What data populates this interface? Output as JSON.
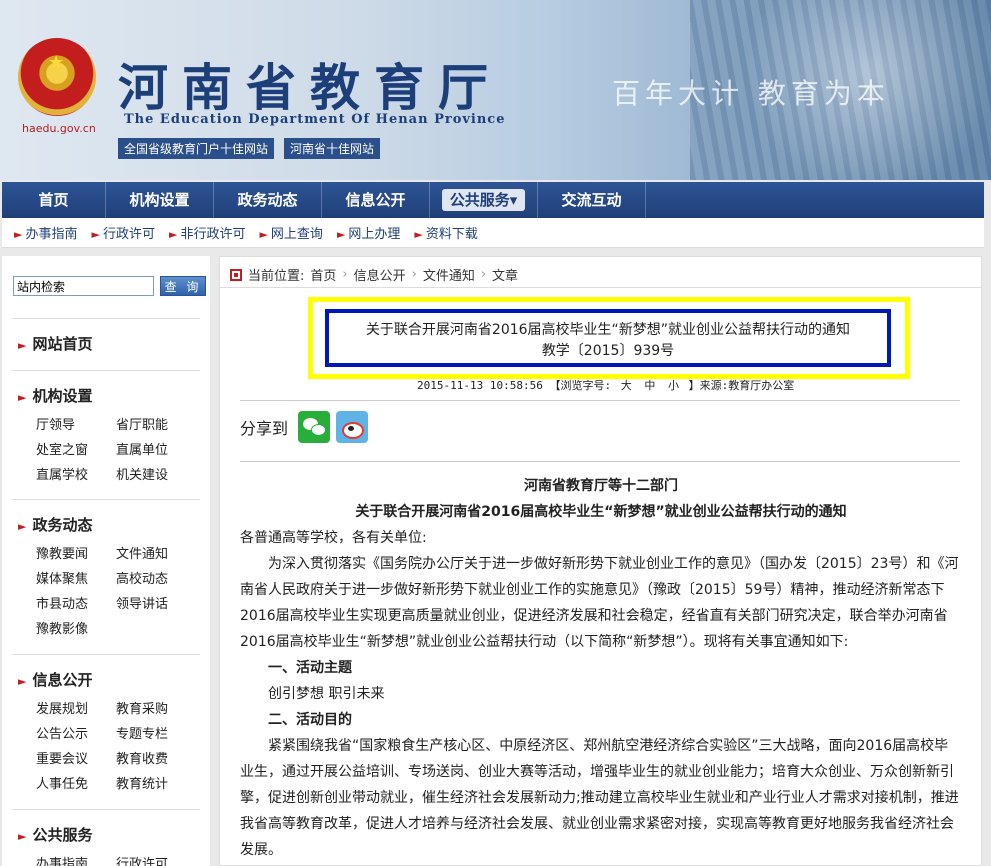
{
  "header": {
    "domain": "haedu.gov.cn",
    "title_cn": "河南省教育厅",
    "title_en": "The Education Department Of Henan Province",
    "badges": [
      "全国省级教育门户十佳网站",
      "河南省十佳网站"
    ],
    "slogan": "百年大计 教育为本"
  },
  "nav": {
    "items": [
      "首页",
      "机构设置",
      "政务动态",
      "信息公开",
      "公共服务",
      "交流互动"
    ],
    "active_dropdown_mark": "▾"
  },
  "subnav": {
    "items": [
      "办事指南",
      "行政许可",
      "非行政许可",
      "网上查询",
      "网上办理",
      "资料下载"
    ]
  },
  "sidebar": {
    "search_value": "站内检索",
    "search_button": "查 询",
    "sections": [
      {
        "title": "网站首页",
        "links": []
      },
      {
        "title": "机构设置",
        "links": [
          "厅领导",
          "省厅职能",
          "处室之窗",
          "直属单位",
          "直属学校",
          "机关建设"
        ]
      },
      {
        "title": "政务动态",
        "links": [
          "豫教要闻",
          "文件通知",
          "媒体聚焦",
          "高校动态",
          "市县动态",
          "领导讲话",
          "豫教影像"
        ]
      },
      {
        "title": "信息公开",
        "links": [
          "发展规划",
          "教育采购",
          "公告公示",
          "专题专栏",
          "重要会议",
          "教育收费",
          "人事任免",
          "教育统计"
        ]
      },
      {
        "title": "公共服务",
        "links": [
          "办事指南",
          "行政许可"
        ]
      }
    ]
  },
  "breadcrumb": {
    "prefix": "当前位置:",
    "items": [
      "首页",
      "信息公开",
      "文件通知",
      "文章"
    ]
  },
  "article": {
    "title": "关于联合开展河南省2016届高校毕业生“新梦想”就业创业公益帮扶行动的通知",
    "doc_no": "教学〔2015〕939号",
    "meta_date": "2015-11-13 10:58:56",
    "meta_font_label": "【浏览字号:",
    "font_sizes": [
      "大",
      "中",
      "小"
    ],
    "meta_source": "】来源:教育厅办公室",
    "share_label": "分享到",
    "heading1": "河南省教育厅等十二部门",
    "heading2": "关于联合开展河南省2016届高校毕业生“新梦想”就业创业公益帮扶行动的通知",
    "salutation": "各普通高等学校，各有关单位:",
    "para1": "为深入贯彻落实《国务院办公厅关于进一步做好新形势下就业创业工作的意见》（国办发〔2015〕23号）和《河南省人民政府关于进一步做好新形势下就业创业工作的实施意见》（豫政〔2015〕59号）精神，推动经济新常态下2016届高校毕业生实现更高质量就业创业，促进经济发展和社会稳定，经省直有关部门研究决定，联合举办河南省2016届高校毕业生“新梦想”就业创业公益帮扶行动（以下简称“新梦想”）。现将有关事宜通知如下:",
    "sub1": "一、活动主题",
    "theme": "创引梦想 职引未来",
    "sub2": "二、活动目的",
    "para2": "紧紧围绕我省“国家粮食生产核心区、中原经济区、郑州航空港经济综合实验区”三大战略，面向2016届高校毕业生，通过开展公益培训、专场送岗、创业大赛等活动，增强毕业生的就业创业能力；培育大众创业、万众创新新引擎，促进创新创业带动就业，催生经济社会发展新动力;推动建立高校毕业生就业和产业行业人才需求对接机制，推进我省高等教育改革，促进人才培养与经济社会发展、就业创业需求紧密对接，实现高等教育更好地服务我省经济社会发展。"
  }
}
